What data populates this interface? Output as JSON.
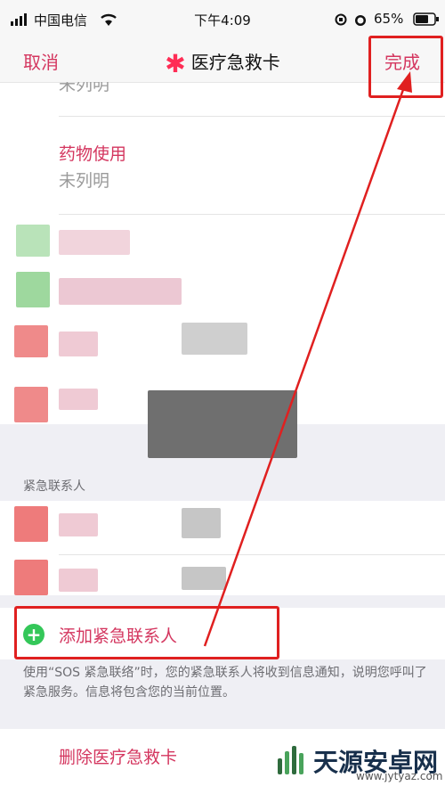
{
  "status_bar": {
    "carrier": "中国电信",
    "time": "下午4:09",
    "battery": "65%"
  },
  "nav": {
    "cancel": "取消",
    "title": "医疗急救卡",
    "done": "完成"
  },
  "fields": {
    "top_value_cut": "未列明",
    "medications_label": "药物使用",
    "medications_value": "未列明"
  },
  "emergency": {
    "section_title": "紧急联系人",
    "add_contact": "添加紧急联系人",
    "footnote": "使用“SOS 紧急联络”时，您的紧急联系人将收到信息通知，说明您呼叫了紧急服务。信息将包含您的当前位置。"
  },
  "delete_card": "删除医疗急救卡",
  "watermark": {
    "name": "天源安卓网",
    "url": "www.jytyaz.com"
  },
  "colors": {
    "accent": "#d4365f",
    "annotation_red": "#e02020",
    "add_green": "#34c759"
  }
}
